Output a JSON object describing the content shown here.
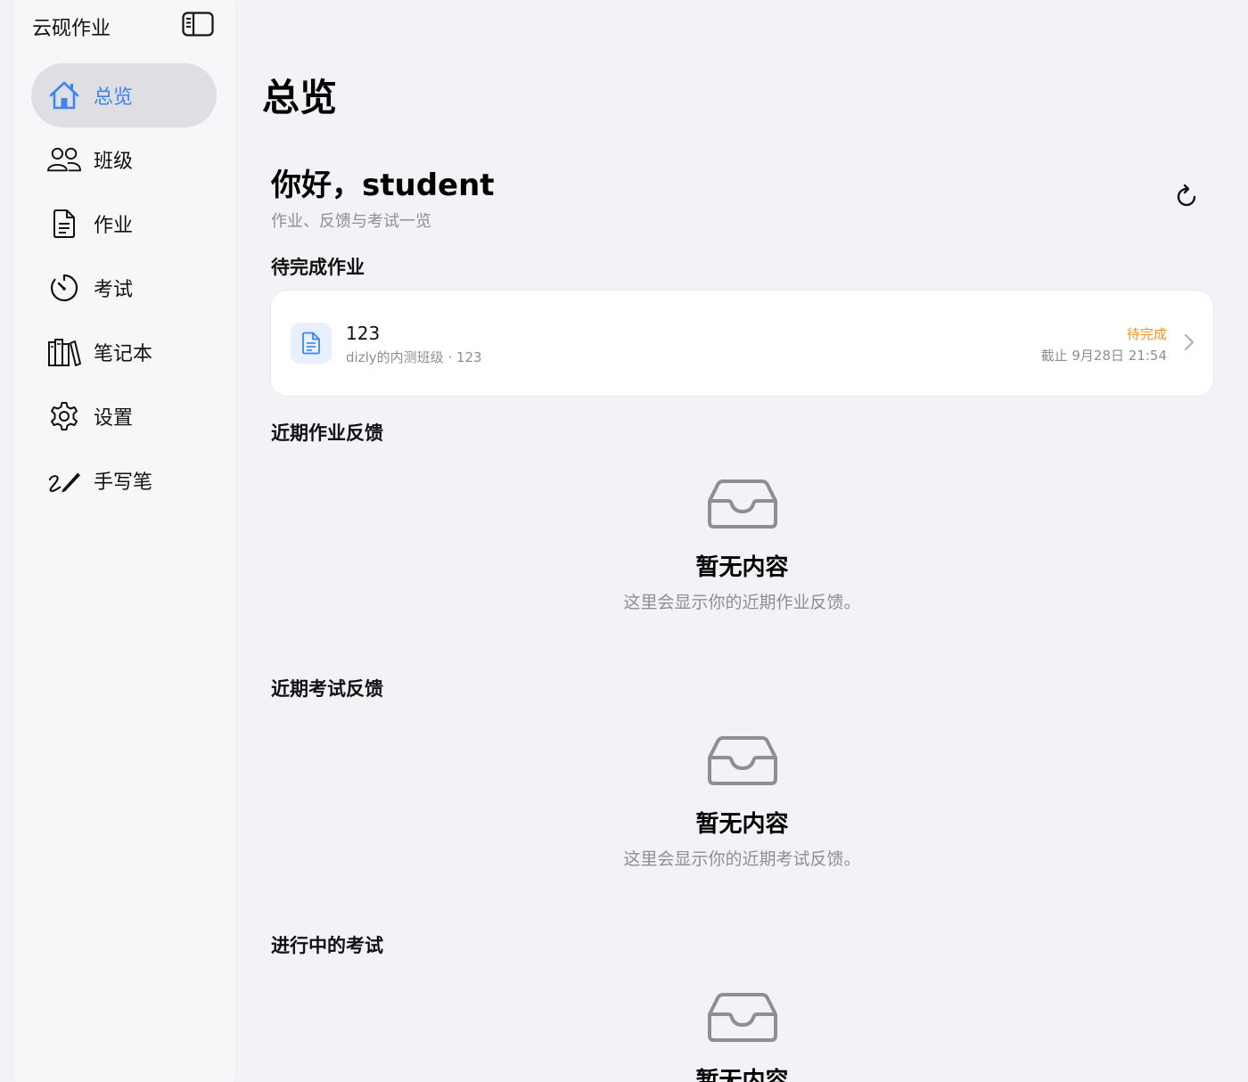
{
  "sidebar": {
    "app_title": "云砚作业",
    "items": [
      {
        "label": "总览",
        "icon": "house-icon",
        "active": true
      },
      {
        "label": "班级",
        "icon": "people-icon"
      },
      {
        "label": "作业",
        "icon": "document-icon"
      },
      {
        "label": "考试",
        "icon": "timer-icon"
      },
      {
        "label": "笔记本",
        "icon": "books-icon"
      },
      {
        "label": "设置",
        "icon": "gear-icon"
      },
      {
        "label": "手写笔",
        "icon": "pencil-scribble-icon"
      }
    ]
  },
  "main": {
    "page_title": "总览",
    "greeting": "你好，student",
    "greeting_sub": "作业、反馈与考试一览",
    "sections": {
      "pending_title": "待完成作业",
      "homework_feedback_title": "近期作业反馈",
      "exam_feedback_title": "近期考试反馈",
      "ongoing_exams_title": "进行中的考试"
    },
    "pending_task": {
      "name": "123",
      "meta": "dizly的内测班级 · 123",
      "status": "待完成",
      "deadline": "截止 9月28日 21:54"
    },
    "empty_homework": {
      "title": "暂无内容",
      "desc": "这里会显示你的近期作业反馈。"
    },
    "empty_exam": {
      "title": "暂无内容",
      "desc": "这里会显示你的近期考试反馈。"
    },
    "empty_ongoing": {
      "title": "暂无内容"
    }
  },
  "colors": {
    "accent": "#3a85f0",
    "pending": "#f0922b",
    "muted": "#8e8e93",
    "background": "#f2f2f7"
  }
}
